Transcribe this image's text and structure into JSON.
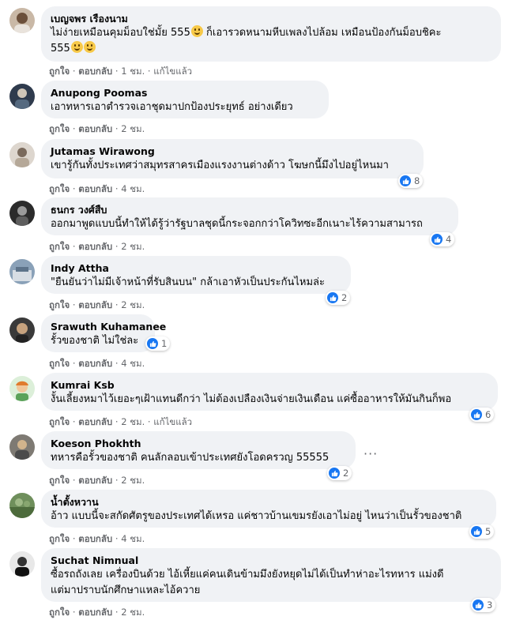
{
  "ui": {
    "accent": "#1877f2",
    "bubble_bg": "#f0f2f5",
    "meta_color": "#65676b"
  },
  "labels": {
    "like": "ถูกใจ",
    "reply": "ตอบกลับ",
    "edited": "แก้ไขแล้ว",
    "more": "···"
  },
  "comments": [
    {
      "author": "เบญจพร เรืองนาม",
      "lines": [
        "ไม่ง่ายเหมือนคุมม็อบใช่มั้ย 555",
        "555"
      ],
      "emoji_after_line1": 1,
      "emoji_after_line2": 2,
      "line1_tail": "ก็เอารวดหนามหีบเพลงไปล้อม เหมือนป้องกันม็อบชิคะ",
      "time": "1 ชม.",
      "edited": true,
      "reactions": null,
      "avatar_icon": "profile-photo"
    },
    {
      "author": "Anupong Poomas",
      "lines": [
        "เอาทหารเอาตำรวจเอาชุดมาปกป้องประยุทธ์ อย่างเดียว"
      ],
      "time": "2 ชม.",
      "reactions": null,
      "avatar_icon": "profile-photo"
    },
    {
      "author": "Jutamas Wirawong",
      "lines": [
        "เขารู้กันทั้งประเทศว่าสมุทรสาครเมืองแรงงานต่างด้าว โฆษกนี้มึงไปอยู่ไหนมา"
      ],
      "time": "4 ชม.",
      "reactions": "8",
      "avatar_icon": "profile-photo"
    },
    {
      "author": "ธนกร วงศ์สืบ",
      "lines": [
        "ออกมาพูดแบบนี้ทำให้ได้รู้ว่ารัฐบาลชุดนี้กระจอกกว่าโควิทซะอีกเนาะไร้ความสามารถ"
      ],
      "time": "2 ชม.",
      "reactions": "4",
      "avatar_icon": "profile-photo"
    },
    {
      "author": "Indy Attha",
      "lines": [
        "\"ยืนยันว่าไม่มีเจ้าหน้าที่รับสินบน\" กล้าเอาหัวเป็นประกันไหมล่ะ"
      ],
      "time": "2 ชม.",
      "reactions": "2",
      "avatar_icon": "profile-photo"
    },
    {
      "author": "Srawuth Kuhamanee",
      "lines": [
        "รั้วของชาติ ไม่ใช่ละ"
      ],
      "time": "4 ชม.",
      "reactions": "1",
      "avatar_icon": "profile-photo"
    },
    {
      "author": "Kumrai Ksb",
      "lines": [
        "งั้นเลี้ยงหมาไว้เยอะๆเฝ้าแทนดีกว่า ไม่ต้องเปลืองเงินจ่ายเงินเดือน แค่ซื้ออาหารให้มันกินก็พอ"
      ],
      "time": "2 ชม.",
      "edited": true,
      "reactions": "6",
      "avatar_icon": "profile-photo"
    },
    {
      "author": "Koeson Phokhth",
      "lines": [
        "ทหารคือรั้วของชาติ คนลักลอบเข้าประเทศยังโอดครวญ 55555"
      ],
      "time": "2 ชม.",
      "reactions": "2",
      "avatar_icon": "profile-photo"
    },
    {
      "author": "น้ำตั้งหวาน",
      "lines": [
        "อ้าว แบบนี้จะสกัดศัตรูของประเทศได้เหรอ แค่ชาวบ้านเขมรยังเอาไม่อยู่ ไหนว่าเป็นรั้วของชาติ"
      ],
      "time": "4 ชม.",
      "reactions": "5",
      "avatar_icon": "profile-photo"
    },
    {
      "author": "Suchat Nimnual",
      "lines": [
        "ซื้อรถถังเลย เครื่องบินด้วย ไอ้เหี้ยแค่คนเดินข้ามมึงยังหยุดไม่ได้เป็นทำห่าอะไรทหาร แม่งดี",
        "แต่มาปราบนักศึกษาแหละไอ้ควาย"
      ],
      "time": "2 ชม.",
      "reactions": "3",
      "avatar_icon": "profile-photo"
    }
  ]
}
